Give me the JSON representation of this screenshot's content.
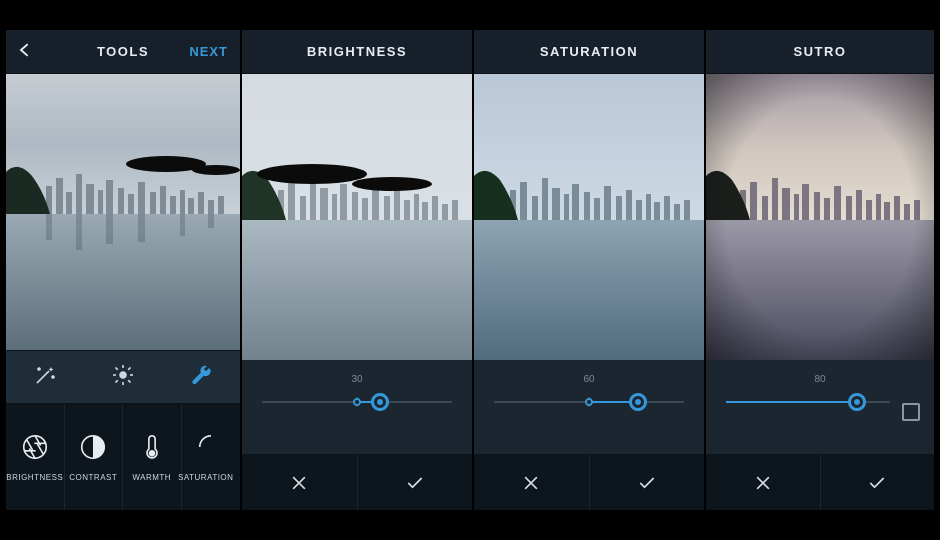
{
  "accent": "#3498db",
  "screens": [
    {
      "id": "tools",
      "title": "TOOLS",
      "next_label": "NEXT",
      "mod_icons": [
        "magic-wand-icon",
        "brightness-sun-icon",
        "wrench-icon"
      ],
      "active_mod_index": 2,
      "tools": [
        {
          "label": "BRIGHTNESS",
          "icon": "aperture-icon"
        },
        {
          "label": "CONTRAST",
          "icon": "contrast-icon"
        },
        {
          "label": "WARMTH",
          "icon": "thermometer-icon"
        },
        {
          "label": "SATURATION",
          "icon": "saturation-icon"
        }
      ]
    },
    {
      "id": "brightness",
      "title": "BRIGHTNESS",
      "value": 30,
      "slider_type": "center",
      "handle_percent": 62
    },
    {
      "id": "saturation",
      "title": "SATURATION",
      "value": 60,
      "slider_type": "center",
      "handle_percent": 76
    },
    {
      "id": "sutro",
      "title": "SUTRO",
      "value": 80,
      "slider_type": "start",
      "handle_percent": 80,
      "show_extra_box": true
    }
  ],
  "photo": {
    "scene": "city-skyline-waterfront",
    "variants": [
      "base",
      "brightened",
      "saturated",
      "sutro-filter"
    ]
  }
}
